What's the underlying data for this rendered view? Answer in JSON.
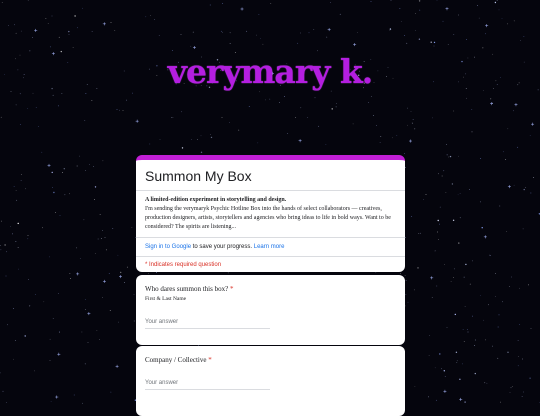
{
  "brand": {
    "logo_text": "verymary k.",
    "color": "#b41ee0"
  },
  "form": {
    "accent": "#c21fd6",
    "title": "Summon My Box",
    "description_bold": "A limited-edition experiment in storytelling and design.",
    "description": "I'm sending the verymaryk Psychic Hotline Box into the hands of select collaborators — creatives, production designers, artists, storytellers and agencies who bring ideas to life in bold ways. Want to be considered? The spirits are listening...",
    "signin_link": "Sign in to Google",
    "signin_text": " to save your progress. ",
    "learn_more": "Learn more",
    "required_note": "* Indicates required question"
  },
  "questions": [
    {
      "title": "Who dares summon this box?",
      "required": "*",
      "subtitle": "First & Last Name",
      "placeholder": "Your answer"
    },
    {
      "title": "Company / Collective",
      "required": "*",
      "subtitle": "",
      "placeholder": "Your answer"
    }
  ]
}
